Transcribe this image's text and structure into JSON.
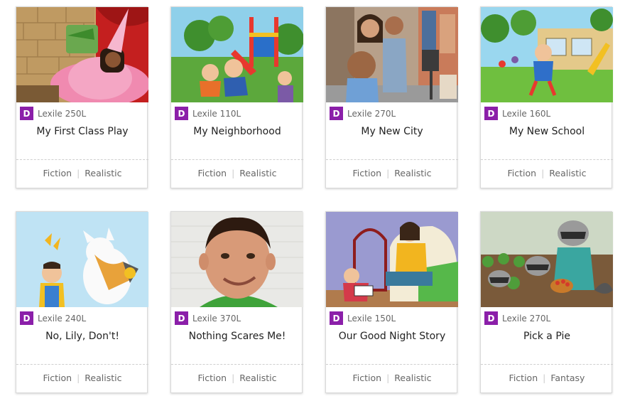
{
  "colors": {
    "badge": "#8b1fa9"
  },
  "cards": [
    {
      "badge": "D",
      "lexile": "Lexile 250L",
      "title": "My First Class Play",
      "genre": "Fiction",
      "subgenre": "Realistic",
      "image": "princess-play-illustration"
    },
    {
      "badge": "D",
      "lexile": "Lexile 110L",
      "title": "My Neighborhood",
      "genre": "Fiction",
      "subgenre": "Realistic",
      "image": "playground-kids-illustration"
    },
    {
      "badge": "D",
      "lexile": "Lexile 270L",
      "title": "My New City",
      "genre": "Fiction",
      "subgenre": "Realistic",
      "image": "family-city-street-illustration"
    },
    {
      "badge": "D",
      "lexile": "Lexile 160L",
      "title": "My New School",
      "genre": "Fiction",
      "subgenre": "Realistic",
      "image": "schoolyard-kids-illustration"
    },
    {
      "badge": "D",
      "lexile": "Lexile 240L",
      "title": "No, Lily, Don't!",
      "genre": "Fiction",
      "subgenre": "Realistic",
      "image": "cat-butterfly-child-illustration"
    },
    {
      "badge": "D",
      "lexile": "Lexile 370L",
      "title": "Nothing Scares Me!",
      "genre": "Fiction",
      "subgenre": "Realistic",
      "image": "smiling-boy-photo"
    },
    {
      "badge": "D",
      "lexile": "Lexile 150L",
      "title": "Our Good Night Story",
      "genre": "Fiction",
      "subgenre": "Realistic",
      "image": "mother-child-reading-illustration"
    },
    {
      "badge": "D",
      "lexile": "Lexile 270L",
      "title": "Pick a Pie",
      "genre": "Fiction",
      "subgenre": "Fantasy",
      "image": "raccoons-garden-illustration"
    }
  ]
}
